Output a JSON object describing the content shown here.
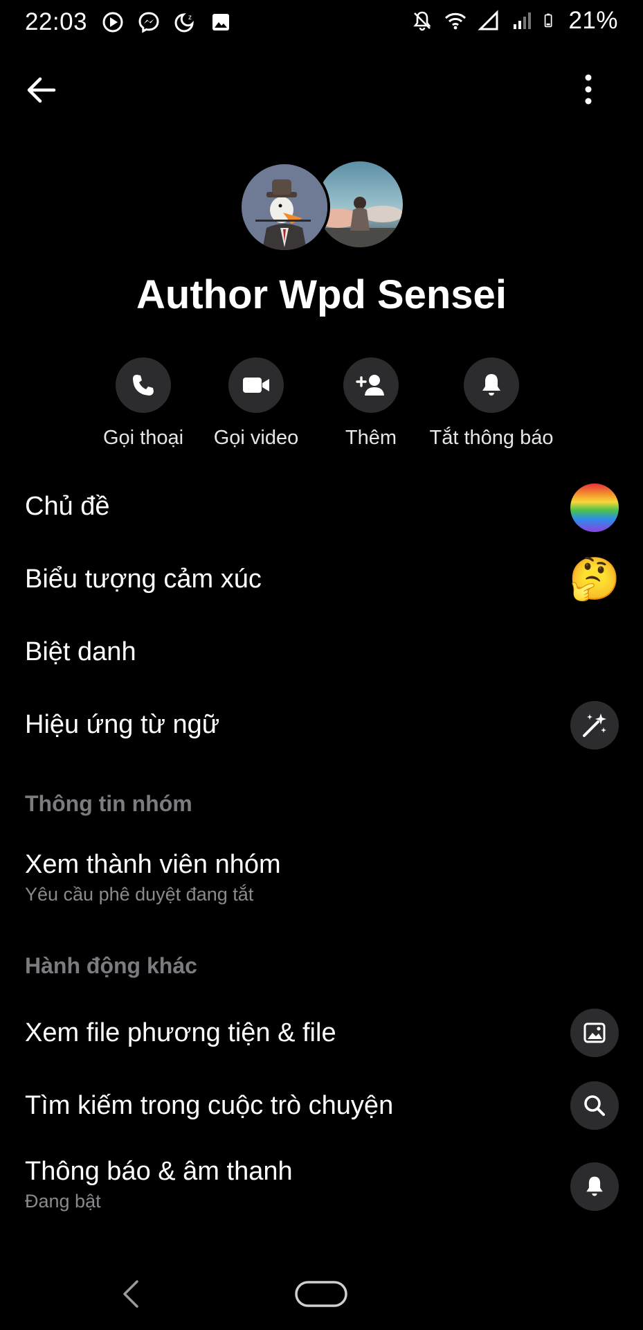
{
  "status_bar": {
    "time": "22:03",
    "battery_percent": "21%",
    "left_icons": [
      "play-icon",
      "messenger-icon",
      "sleep-mode-icon",
      "image-icon"
    ],
    "right_icons": [
      "notifications-off-icon",
      "wifi-icon",
      "signal-icon",
      "signal-2-icon",
      "battery-icon"
    ]
  },
  "header": {
    "back_icon": "arrow-left-icon",
    "menu_icon": "more-vertical-icon"
  },
  "profile": {
    "name": "Author Wpd Sensei"
  },
  "actions": [
    {
      "label": "Gọi thoại",
      "icon": "phone-icon"
    },
    {
      "label": "Gọi video",
      "icon": "video-icon"
    },
    {
      "label": "Thêm",
      "icon": "add-person-icon"
    },
    {
      "label": "Tắt thông báo",
      "icon": "bell-icon"
    }
  ],
  "settings": {
    "theme": {
      "label": "Chủ đề",
      "accent_colors": [
        "#e8323c",
        "#f28b2d",
        "#f7d839",
        "#4cc24a",
        "#2d8ee8",
        "#8a43e0"
      ]
    },
    "emoji": {
      "label": "Biểu tượng cảm xúc",
      "value": "🤔"
    },
    "nickname": {
      "label": "Biệt danh"
    },
    "word_effects": {
      "label": "Hiệu ứng từ ngữ",
      "icon": "magic-wand-icon"
    }
  },
  "group_info": {
    "section_title": "Thông tin nhóm",
    "members": {
      "label": "Xem thành viên nhóm",
      "sub": "Yêu cầu phê duyệt đang tắt"
    }
  },
  "other_actions": {
    "section_title": "Hành động khác",
    "media": {
      "label": "Xem file phương tiện & file",
      "icon": "image-icon"
    },
    "search": {
      "label": "Tìm kiếm trong cuộc trò chuyện",
      "icon": "search-icon"
    },
    "notifications": {
      "label": "Thông báo & âm thanh",
      "sub": "Đang bật",
      "icon": "bell-icon"
    }
  },
  "theme_colors": {
    "background": "#000000",
    "surface": "#2c2c2e",
    "secondary_text": "#8a8a8e"
  }
}
